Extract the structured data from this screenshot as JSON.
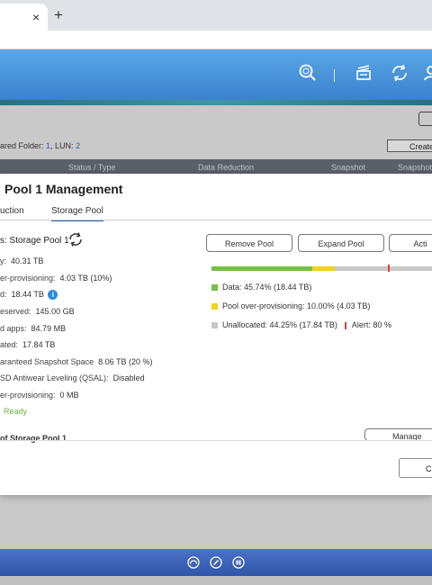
{
  "browser": {
    "tab_close": "×",
    "new_tab": "+"
  },
  "header_icons": [
    "search-icon",
    "document-stack-icon",
    "sync-icon",
    "user-icon"
  ],
  "background": {
    "folder_line_prefix": "ared Folder: ",
    "folder_count": "1",
    "lun_label": ", LUN: ",
    "lun_count": "2",
    "create_label": "Create",
    "columns": [
      "Status / Type",
      "Data Reduction",
      "Snapshot",
      "Snapshot"
    ]
  },
  "modal": {
    "title": "Pool 1 Management",
    "tabs": [
      "uction",
      "Storage Pool"
    ],
    "pool_name": "s: Storage Pool 1",
    "properties": [
      {
        "label": "y:",
        "value": "40.31 TB"
      },
      {
        "label": "er-provisioning:",
        "value": "4.03 TB (10%)"
      },
      {
        "label": "d:",
        "value": "18.44 TB"
      },
      {
        "label": "eserved:",
        "value": "145.00 GB"
      },
      {
        "label": "d apps:",
        "value": "84.79 MB"
      },
      {
        "label": "ated:",
        "value": "17.84 TB"
      },
      {
        "label": "aranteed Snapshot Space",
        "value": "8.06 TB (20 %)"
      },
      {
        "label": "SD Antiwear Leveling (QSAL):",
        "value": "Disabled"
      },
      {
        "label": "er-provisioning:",
        "value": "0 MB"
      }
    ],
    "status": "Ready",
    "info_glyph": "i",
    "buttons": {
      "remove": "Remove Pool",
      "expand": "Expand Pool",
      "action": "Acti"
    },
    "usage": {
      "data_pct": 45.74,
      "overprov_pct": 10.0,
      "unallocated_pct": 44.25,
      "alert_pct": 80,
      "colors": {
        "data": "#76c043",
        "overprov": "#f2d21a",
        "unallocated": "#c8c8c8",
        "alert": "#e0403a"
      }
    },
    "legend": {
      "data": "Data: 45.74% (18.44 TB)",
      "overprov": "Pool over-provisioning: 10.00% (4.03 TB)",
      "unallocated": "Unallocated: 44.25% (17.84 TB)",
      "alert": "Alert: 80 %"
    },
    "section_title": "of Storage Pool 1",
    "manage_label": "Manage",
    "close_label": "C"
  },
  "taskbar_icons": [
    "dashboard-icon",
    "tools-icon",
    "apps-icon"
  ]
}
